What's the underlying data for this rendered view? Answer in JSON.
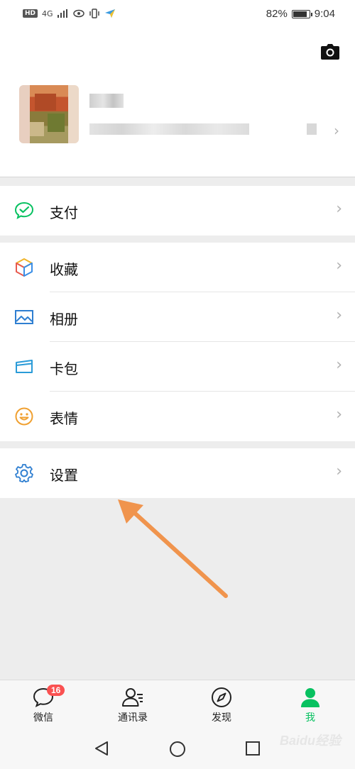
{
  "status_bar": {
    "network": "HD",
    "signal": "4G",
    "battery_percent": "82%",
    "time": "9:04",
    "battery_level": 0.82
  },
  "profile": {
    "camera_icon": "camera-icon",
    "chevron": "›"
  },
  "menu": {
    "pay": {
      "label": "支付",
      "icon": "wechat-pay-icon"
    },
    "favorites": {
      "label": "收藏",
      "icon": "cube-icon"
    },
    "album": {
      "label": "相册",
      "icon": "picture-icon"
    },
    "cards": {
      "label": "卡包",
      "icon": "card-icon"
    },
    "stickers": {
      "label": "表情",
      "icon": "smiley-icon"
    },
    "settings": {
      "label": "设置",
      "icon": "gear-icon"
    },
    "chevron": "›"
  },
  "bottom_nav": {
    "chats": {
      "label": "微信",
      "badge": "16"
    },
    "contacts": {
      "label": "通讯录"
    },
    "discover": {
      "label": "发现"
    },
    "me": {
      "label": "我"
    }
  },
  "colors": {
    "accent": "#07c160",
    "badge": "#fa5151",
    "arrow": "#f0944d"
  },
  "watermark": "Baidu经验"
}
